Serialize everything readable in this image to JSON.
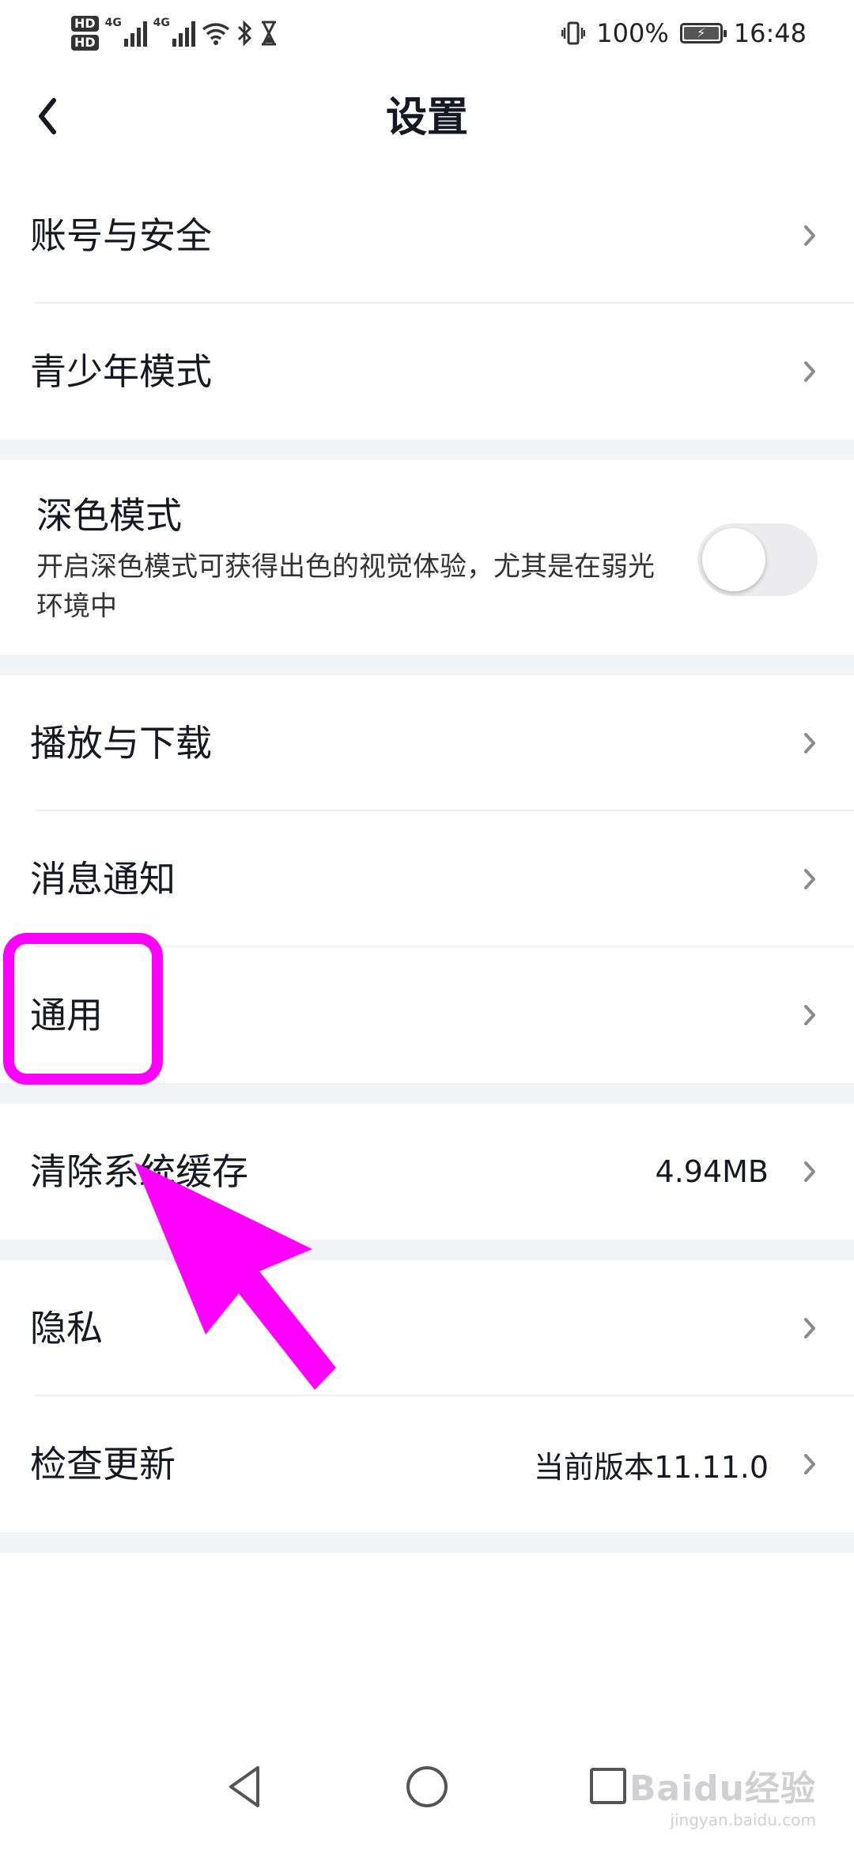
{
  "status_bar": {
    "hd1": "HD",
    "hd2": "HD",
    "net1": "4G",
    "net2": "4G",
    "battery_percent": "100%",
    "time": "16:48",
    "icons": [
      "signal-icon",
      "wifi-icon",
      "bluetooth-icon",
      "hourglass-icon",
      "vibrate-icon",
      "battery-icon"
    ]
  },
  "header": {
    "title": "设置",
    "back_icon": "chevron-left-icon"
  },
  "sections": {
    "account": "账号与安全",
    "youth": "青少年模式",
    "dark_mode": {
      "title": "深色模式",
      "description": "开启深色模式可获得出色的视觉体验，尤其是在弱光环境中",
      "enabled": false
    },
    "playback": "播放与下载",
    "notifications": "消息通知",
    "general": "通用",
    "clear_cache": {
      "label": "清除系统缓存",
      "value": "4.94MB"
    },
    "privacy": "隐私",
    "check_update": {
      "label": "检查更新",
      "value": "当前版本11.11.0"
    }
  },
  "annotation": {
    "highlight_color": "#ff00ff"
  },
  "nav_bar": {
    "icons": [
      "back-triangle-icon",
      "home-circle-icon",
      "recents-square-icon"
    ]
  },
  "watermark": {
    "text": "Baidu经验",
    "sub": "jingyan.baidu.com"
  }
}
